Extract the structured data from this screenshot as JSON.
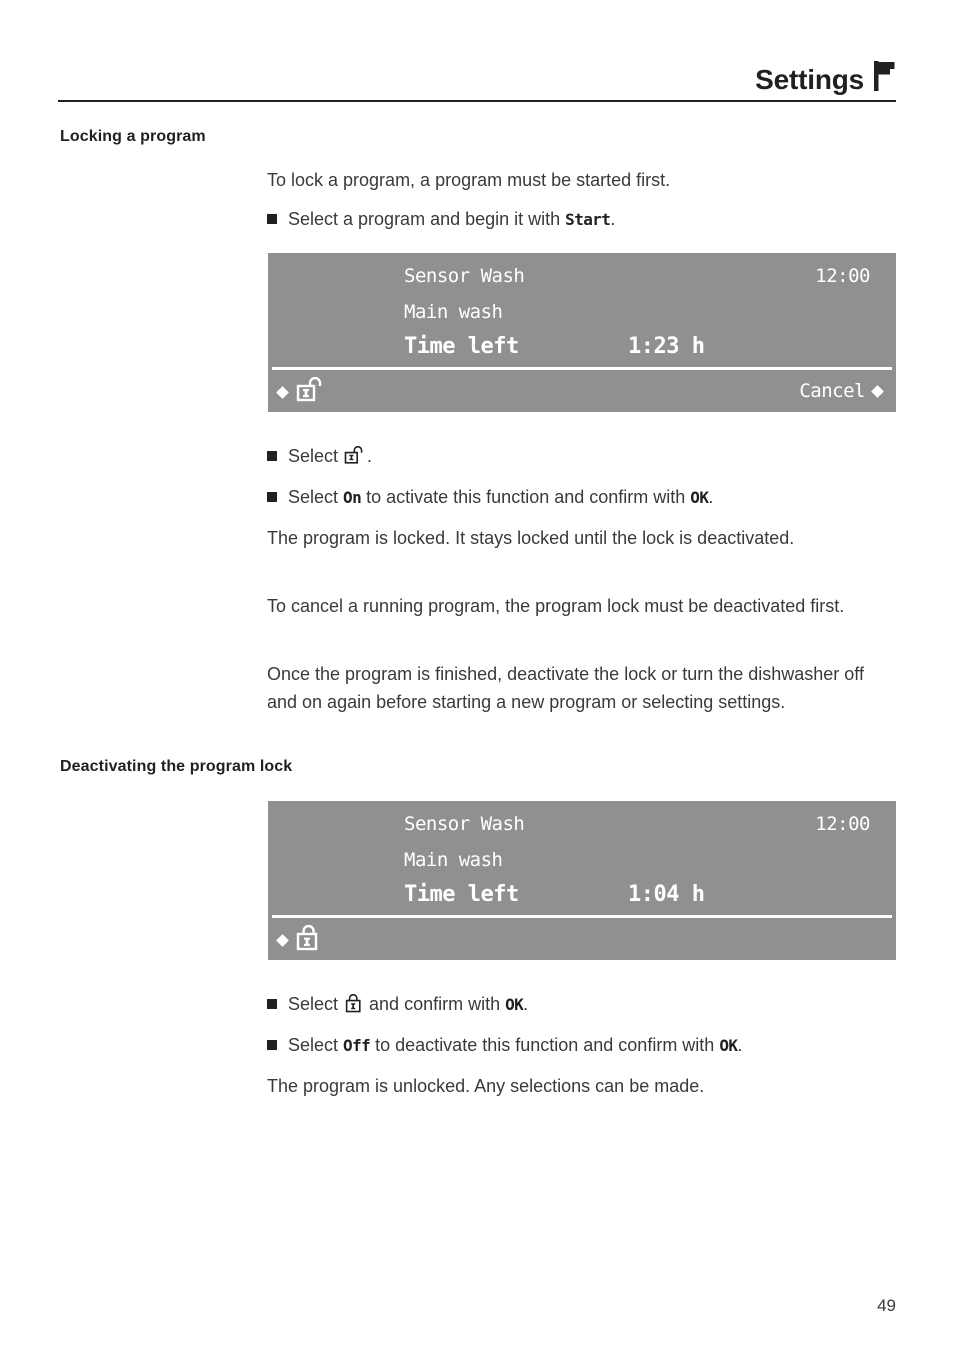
{
  "header": {
    "title": "Settings",
    "icon": "flag-icon"
  },
  "sections": [
    {
      "heading": "Locking a program",
      "intro": "To lock a program, a program must be started first.",
      "bullet_start": {
        "prefix": "Select a program and begin it with ",
        "lcd": "Start",
        "suffix": "."
      },
      "bullet_select_lock": {
        "prefix": "Select ",
        "icon": "padlock-open-icon",
        "suffix": "."
      },
      "bullet_on": {
        "prefix": "Select ",
        "lcd1": "On",
        "middle": " to activate this function and confirm with ",
        "lcd2": "OK",
        "suffix": "."
      },
      "paragraphs": [
        "The program is locked. It stays locked until the lock is deactivated.",
        "To cancel a running program, the program lock must be deactivated first.",
        "Once the program is finished, deactivate the lock or turn the dishwasher off and on again before starting a new program or selecting settings."
      ]
    },
    {
      "heading": "Deactivating the program lock",
      "bullet_select_lock": {
        "prefix": "Select ",
        "icon": "padlock-closed-icon",
        "middle": " and confirm with ",
        "lcd": "OK",
        "suffix": "."
      },
      "bullet_off": {
        "prefix": "Select ",
        "lcd1": "Off",
        "middle": " to deactivate this function and confirm with ",
        "lcd2": "OK",
        "suffix": "."
      },
      "paragraph": "The program is unlocked. Any selections can be made."
    }
  ],
  "displays": [
    {
      "program": "Sensor Wash",
      "clock": "12:00",
      "phase": "Main wash",
      "time_left_label": "Time left",
      "time_left_value": "1:23 h",
      "footer_lock_icon": "padlock-open-icon",
      "footer_right_label": "Cancel"
    },
    {
      "program": "Sensor Wash",
      "clock": "12:00",
      "phase": "Main wash",
      "time_left_label": "Time left",
      "time_left_value": "1:04 h",
      "footer_lock_icon": "padlock-closed-icon",
      "footer_right_label": ""
    }
  ],
  "page_number": "49",
  "colors": {
    "display_background": "#909090",
    "display_text": "#ffffff",
    "body_text": "#3a3a3c",
    "heading_text": "#231f20"
  }
}
